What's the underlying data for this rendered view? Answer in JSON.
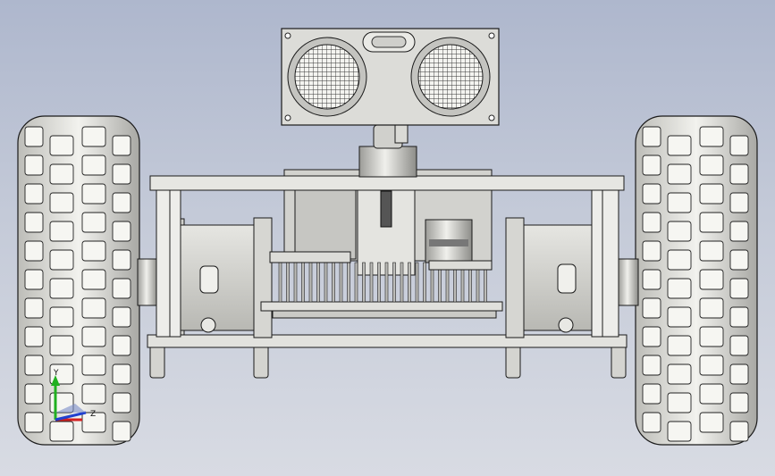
{
  "viewport": {
    "background_top": "#aeb7cd",
    "background_bottom": "#d8dbe3"
  },
  "model": {
    "part_fill": "#dcdcd8",
    "part_shadow": "#8a8a86",
    "edge_color": "#1a1a1a",
    "components": [
      "ultrasonic-sensor",
      "servo-mount",
      "top-plate",
      "bottom-plate",
      "left-motor",
      "right-motor",
      "left-wheel",
      "right-wheel",
      "circuit-board"
    ]
  },
  "triad": {
    "labels": {
      "y": "Y",
      "z": "Z"
    },
    "colors": {
      "x": "#d22020",
      "y": "#20b020",
      "z": "#2040d0"
    }
  }
}
